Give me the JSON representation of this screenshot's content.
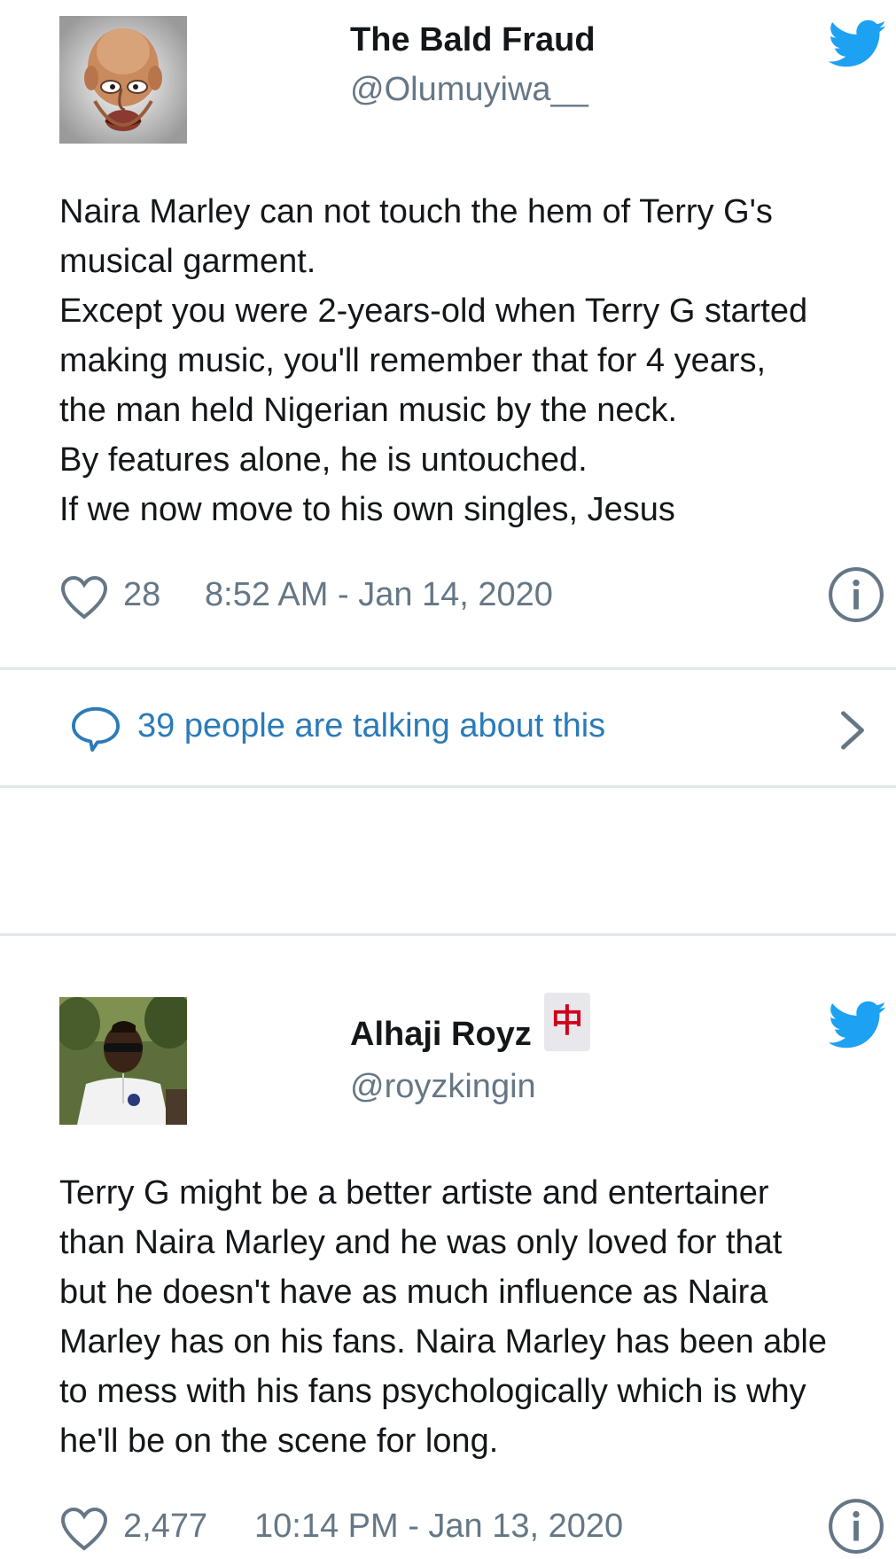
{
  "tweets": [
    {
      "name": "The Bald Fraud",
      "handle": "@Olumuyiwa__",
      "avatar_icon": "caricature-avatar",
      "lines": [
        "Naira Marley can not touch the hem of Terry G's",
        "musical garment.",
        "Except you were 2-years-old when Terry G started",
        "making music, you'll remember that for 4 years,",
        "the man held Nigerian music by the neck.",
        "By features alone, he is untouched.",
        "If we now move to his own singles, Jesus"
      ],
      "likes": "28",
      "timestamp": "8:52 AM - Jan 14, 2020",
      "talking": "39 people are talking about this"
    },
    {
      "name": "Alhaji Royz",
      "name_emoji": "中",
      "handle": "@royzkingin",
      "avatar_icon": "photo-avatar",
      "lines": [
        "Terry G might be a better artiste and entertainer",
        "than Naira Marley and he was only loved for that",
        "but he doesn't have as much influence as Naira",
        "Marley has on his fans. Naira Marley has been able",
        "to mess with his fans psychologically which is why",
        "he'll be on the scene for long."
      ],
      "likes": "2,477",
      "timestamp": "10:14 PM - Jan 13, 2020"
    }
  ],
  "colors": {
    "twitter_blue": "#1da1f2",
    "link_blue": "#2b7bb9",
    "meta_gray": "#657786",
    "divider": "#e1e8ed",
    "flag_red": "#d0021b"
  }
}
